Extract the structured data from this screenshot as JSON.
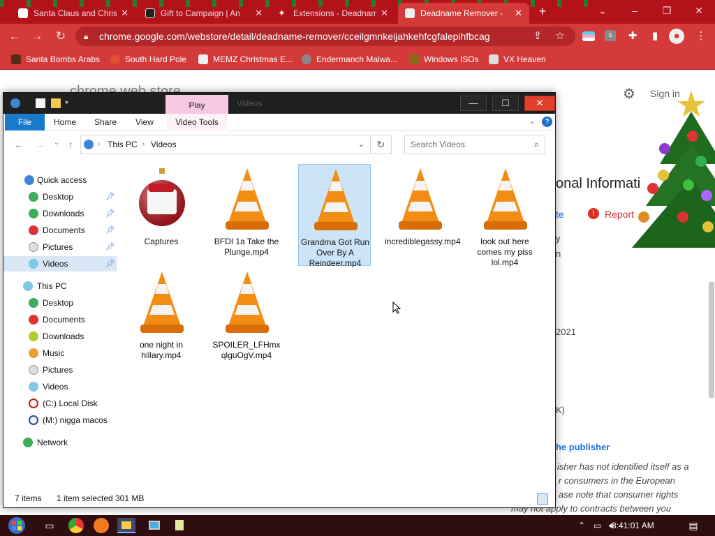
{
  "browser": {
    "tabs": [
      {
        "title": "Santa Claus and Christ",
        "favicon_color": "#ffffff"
      },
      {
        "title": "Gift to Campaign | An",
        "favicon_color": "#222222"
      },
      {
        "title": "Extensions - Deadnam",
        "favicon_color": "#ffffff"
      },
      {
        "title": "Deadname Remover -",
        "favicon_color": "#f0f0f0"
      }
    ],
    "new_tab": "+",
    "url": "chrome.google.com/webstore/detail/deadname-remover/cceilgmnkeijahkehfcgfalepihfbcag",
    "bookmarks": [
      {
        "label": "Santa Bombs Arabs",
        "icon_color": "#5a2b1a"
      },
      {
        "label": "South Hard Pole",
        "icon_color": "#e05030"
      },
      {
        "label": "MEMZ Christmas E...",
        "icon_color": "#f0f0f0"
      },
      {
        "label": "Endermanch Malwa...",
        "icon_color": "#888888"
      },
      {
        "label": "Windows ISOs",
        "icon_color": "#8a6a1a"
      },
      {
        "label": "VX Heaven",
        "icon_color": "#dddddd"
      }
    ],
    "accent": "#d43a3a"
  },
  "webpage": {
    "store_title": "chrome web store",
    "sign_in": "Sign in",
    "heading": "onal Informati",
    "link_te": "te",
    "report": "Report",
    "text_y": "y",
    "text_n": "n",
    "year": "2021",
    "text_k": "K)",
    "publisher_link": "he publisher",
    "para1": "isher has not identified itself as a",
    "para2": "r consumers in the European",
    "para3": "ase note that consumer rights",
    "para4": "may not apply to contracts between you"
  },
  "explorer": {
    "title": "Videos",
    "context_tab": "Play",
    "ribbon_tabs": [
      "File",
      "Home",
      "Share",
      "View",
      "Video Tools"
    ],
    "help": "?",
    "address": [
      "This PC",
      "Videos"
    ],
    "search_placeholder": "Search Videos",
    "nav": {
      "quick_access": "Quick access",
      "quick_items": [
        "Desktop",
        "Downloads",
        "Documents",
        "Pictures",
        "Videos"
      ],
      "this_pc": "This PC",
      "pc_items": [
        "Desktop",
        "Documents",
        "Downloads",
        "Music",
        "Pictures",
        "Videos",
        "(C:) Local Disk",
        "(M:) nigga macos"
      ],
      "network": "Network"
    },
    "files": [
      {
        "name": "Captures",
        "type": "folder"
      },
      {
        "name": "BFDI 1a Take the Plunge.mp4",
        "type": "video"
      },
      {
        "name": "Grandma Got Run Over By A Reindeer.mp4",
        "type": "video",
        "selected": true
      },
      {
        "name": "incrediblegassy.mp4",
        "type": "video"
      },
      {
        "name": "look out here comes my piss lol.mp4",
        "type": "video"
      },
      {
        "name": "one night in hillary.mp4",
        "type": "video"
      },
      {
        "name": "SPOILER_LFHmxqlguOgV.mp4",
        "type": "video"
      }
    ],
    "status": {
      "count": "7 items",
      "selection": "1 item selected",
      "size": "301 MB"
    }
  },
  "taskbar": {
    "clock": "8:41:01 AM",
    "apps": [
      "task-view-icon",
      "chrome-icon",
      "firefox-icon",
      "file-explorer-icon",
      "monitor-icon",
      "notepad-icon"
    ]
  }
}
